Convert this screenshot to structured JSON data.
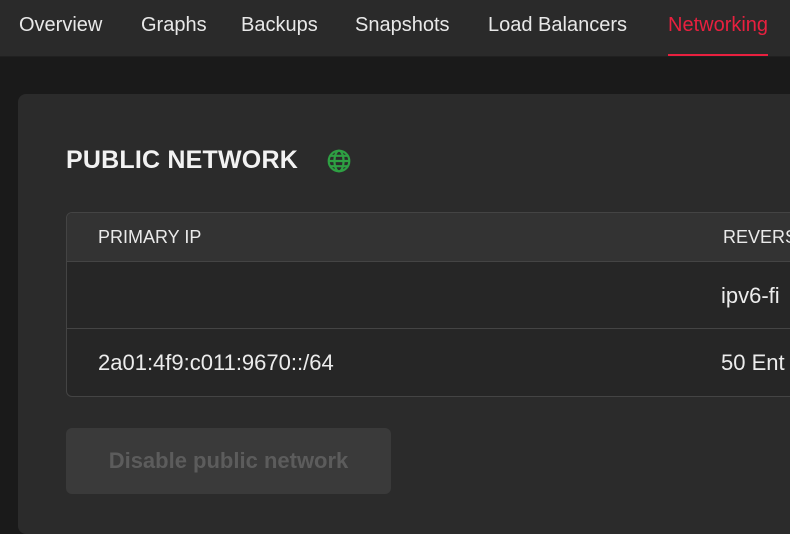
{
  "nav": {
    "tabs": [
      {
        "label": "Overview"
      },
      {
        "label": "Graphs"
      },
      {
        "label": "Backups"
      },
      {
        "label": "Snapshots"
      },
      {
        "label": "Load Balancers"
      },
      {
        "label": "Networking",
        "active": true
      }
    ],
    "active_color": "#e8203f"
  },
  "public_network": {
    "title": "PUBLIC NETWORK",
    "icon": "globe-icon",
    "icon_color": "#2ea043",
    "table": {
      "columns": [
        "PRIMARY IP",
        "REVERS"
      ],
      "rows": [
        [
          "",
          "ipv6-fi"
        ],
        [
          "2a01:4f9:c011:9670::/64",
          "50 Ent"
        ]
      ]
    },
    "disable_button_label": "Disable public network"
  }
}
